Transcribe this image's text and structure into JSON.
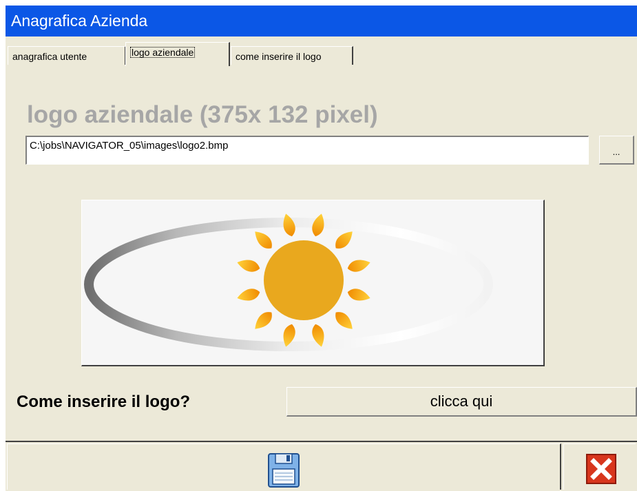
{
  "window": {
    "title": "Anagrafica Azienda"
  },
  "tabs": [
    {
      "label": "anagrafica utente",
      "active": false
    },
    {
      "label": "logo aziendale",
      "active": true
    },
    {
      "label": "come inserire il logo",
      "active": false
    }
  ],
  "logo_section": {
    "heading": "logo aziendale (375x 132 pixel)",
    "path_value": "C:\\jobs\\NAVIGATOR_05\\images\\logo2.bmp",
    "browse_label": "...",
    "preview_icon": "sun-logo"
  },
  "help": {
    "question": "Come inserire il logo?",
    "button_label": "clicca qui"
  },
  "toolbar": {
    "save_icon": "floppy-disk-icon",
    "close_icon": "red-x-icon"
  },
  "colors": {
    "titlebar": "#0b57e6",
    "window_bg": "#ece9d8",
    "heading_gray": "#a6a6a6",
    "sun_orange": "#f3a712",
    "close_red": "#d8361d"
  }
}
